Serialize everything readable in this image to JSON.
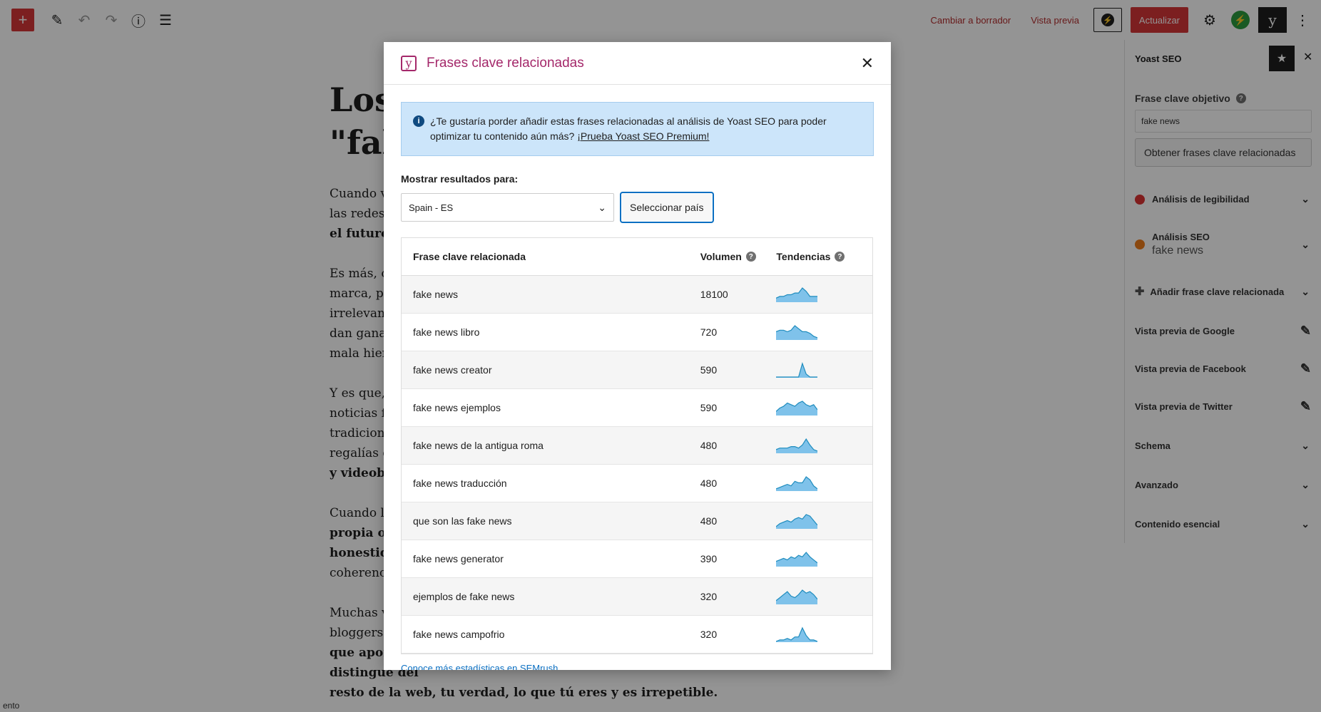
{
  "toolbar": {
    "add_icon": "plus-icon",
    "cambiar_borrador": "Cambiar a borrador",
    "vista_previa": "Vista previa",
    "actualizar": "Actualizar"
  },
  "editor": {
    "title_line1": "Los",
    "title_line2": "\"fak",
    "p1_l1": "Cuando v",
    "p1_l2": "las redes s",
    "p1_l3": "el futuro",
    "p2_l1": "Es más, c",
    "p2_l2": "marca, pe",
    "p2_l3": "irrelevant",
    "p2_l4": "dan ganas",
    "p2_l5": "mala hier",
    "p3_l1": "Y es que, p",
    "p3_l2": "noticias fa",
    "p3_l3": "tradiciona",
    "p3_l4": "regalías d",
    "p3_l5": "y videobl",
    "p4_l1": "Cuando le",
    "p4_l2": "propia op",
    "p4_l3": "honestida",
    "p4_l4": "coherenci",
    "p5_l1": "Muchas v",
    "p5_l2": "bloggers t",
    "p5_l3": "que aportar a internet es tu propia identidad, lo que te distingue del",
    "p5_l4": "resto de la web, tu verdad, lo que tú eres y es irrepetible."
  },
  "sidebar": {
    "title": "Yoast SEO",
    "frase_label": "Frase clave objetivo",
    "frase_value": "fake news",
    "obtener_btn": "Obtener frases clave relacionadas",
    "legibilidad": "Análisis de legibilidad",
    "seo_title": "Análisis SEO",
    "seo_sub": "fake news",
    "add_related": "Añadir frase clave relacionada",
    "google": "Vista previa de Google",
    "facebook": "Vista previa de Facebook",
    "twitter": "Vista previa de Twitter",
    "schema": "Schema",
    "avanzado": "Avanzado",
    "contenido": "Contenido esencial",
    "colors": {
      "red": "#dc3232",
      "orange": "#ee7c1b"
    }
  },
  "modal": {
    "title": "Frases clave relacionadas",
    "alert_text": "¿Te gustaría porder añadir estas frases relacionadas al análisis de Yoast SEO para poder optimizar tu contenido aún más?",
    "alert_link": "¡Prueba Yoast SEO Premium!",
    "show_label": "Mostrar resultados para:",
    "select_value": "Spain - ES",
    "select_button": "Seleccionar país",
    "col_phrase": "Frase clave relacionada",
    "col_volume": "Volumen",
    "col_trends": "Tendencias",
    "rows": [
      {
        "phrase": "fake news",
        "volume": "18100",
        "trend": [
          2,
          3,
          3,
          4,
          4,
          5,
          5,
          8,
          6,
          3,
          3,
          3
        ]
      },
      {
        "phrase": "fake news libro",
        "volume": "720",
        "trend": [
          5,
          6,
          6,
          5,
          6,
          9,
          7,
          5,
          5,
          4,
          2,
          1
        ]
      },
      {
        "phrase": "fake news creator",
        "volume": "590",
        "trend": [
          0,
          0,
          0,
          0,
          0,
          0,
          0,
          9,
          2,
          0,
          0,
          0
        ]
      },
      {
        "phrase": "fake news ejemplos",
        "volume": "590",
        "trend": [
          2,
          4,
          5,
          7,
          6,
          5,
          7,
          8,
          6,
          5,
          6,
          3
        ]
      },
      {
        "phrase": "fake news de la antigua roma",
        "volume": "480",
        "trend": [
          2,
          3,
          3,
          3,
          4,
          4,
          3,
          5,
          9,
          5,
          2,
          1
        ]
      },
      {
        "phrase": "fake news traducción",
        "volume": "480",
        "trend": [
          1,
          2,
          3,
          4,
          3,
          6,
          5,
          5,
          9,
          7,
          3,
          1
        ]
      },
      {
        "phrase": "que son las fake news",
        "volume": "480",
        "trend": [
          1,
          3,
          4,
          5,
          4,
          6,
          7,
          6,
          9,
          8,
          5,
          2
        ]
      },
      {
        "phrase": "fake news generator",
        "volume": "390",
        "trend": [
          3,
          4,
          5,
          4,
          6,
          5,
          7,
          6,
          9,
          6,
          4,
          2
        ]
      },
      {
        "phrase": "ejemplos de fake news",
        "volume": "320",
        "trend": [
          2,
          4,
          6,
          8,
          5,
          4,
          6,
          9,
          7,
          8,
          6,
          3
        ]
      },
      {
        "phrase": "fake news campofrio",
        "volume": "320",
        "trend": [
          0,
          1,
          1,
          2,
          1,
          3,
          3,
          9,
          4,
          1,
          1,
          0
        ]
      }
    ],
    "footer_link": "Conoce más estadísticas en SEMrush",
    "trend_color": "#1e8cbe",
    "trend_fill": "#7fc2ea"
  },
  "status_bar": "ento"
}
